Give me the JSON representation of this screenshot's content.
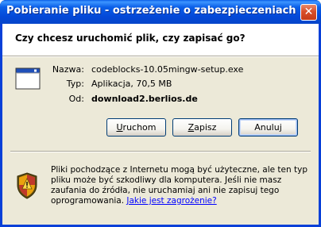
{
  "window": {
    "title": "Pobieranie pliku - ostrzeżenie o zabezpieczeniach",
    "close_glyph": "✕"
  },
  "dialog": {
    "question": "Czy chcesz uruchomić plik, czy zapisać go?",
    "file": {
      "name_label": "Nazwa:",
      "name_value": "codeblocks-10.05mingw-setup.exe",
      "type_label": "Typ:",
      "type_value": "Aplikacja, 70,5 MB",
      "from_label": "Od:",
      "from_value": "download2.berlios.de",
      "icon": "application-window-icon"
    },
    "buttons": {
      "run": {
        "underline": "U",
        "rest": "ruchom"
      },
      "save": {
        "underline": "Z",
        "rest": "apisz"
      },
      "cancel": {
        "label": "Anuluj"
      }
    },
    "warning": {
      "icon": "security-shield-icon",
      "text": "Pliki pochodzące z Internetu mogą być użyteczne, ale ten typ pliku może być szkodliwy dla komputera. Jeśli nie masz zaufania do źródła, nie uruchamiaj ani nie zapisuj tego oprogramowania. ",
      "link": "Jakie jest zagrożenie?"
    }
  },
  "colors": {
    "titlebar": "#0348d8",
    "dialog_bg": "#ece9d8",
    "link": "#0000ff"
  }
}
